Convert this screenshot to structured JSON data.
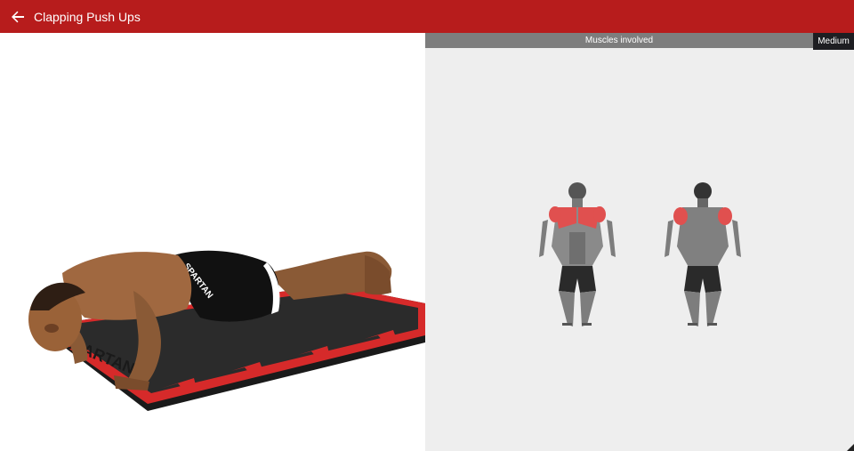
{
  "app_bar": {
    "title": "Clapping Push Ups",
    "back_icon": "arrow-left-icon",
    "background_color": "#b71c1c"
  },
  "exercise_animation": {
    "mat_text": "SPARTAN",
    "shorts_text": "SPARTAN"
  },
  "muscles_panel": {
    "header": "Muscles involved",
    "difficulty": "Medium",
    "highlight_color": "#e0504f"
  }
}
